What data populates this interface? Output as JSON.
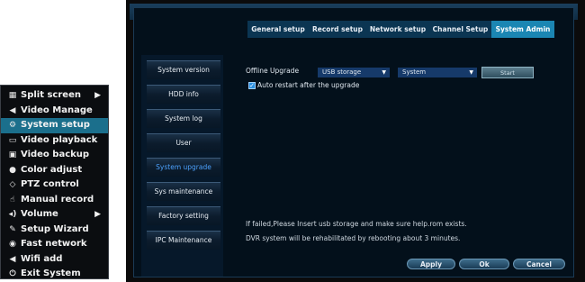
{
  "context_menu": {
    "items": [
      {
        "label": "Split screen",
        "icon": "grid-icon",
        "glyph": "▦",
        "submenu": true
      },
      {
        "label": "Video Manage",
        "icon": "camera-icon",
        "glyph": "◀",
        "submenu": false
      },
      {
        "label": "System setup",
        "icon": "gear-icon",
        "glyph": "⚙",
        "submenu": false,
        "active": true
      },
      {
        "label": "Video playback",
        "icon": "playback-icon",
        "glyph": "▭",
        "submenu": false
      },
      {
        "label": "Video backup",
        "icon": "save-icon",
        "glyph": "▣",
        "submenu": false
      },
      {
        "label": "Color adjust",
        "icon": "palette-icon",
        "glyph": "●",
        "submenu": false
      },
      {
        "label": "PTZ control",
        "icon": "ptz-icon",
        "glyph": "◇",
        "submenu": false
      },
      {
        "label": "Manual record",
        "icon": "hand-icon",
        "glyph": "☝",
        "submenu": false
      },
      {
        "label": "Volume",
        "icon": "speaker-icon",
        "glyph": "◂)",
        "submenu": true
      },
      {
        "label": "Setup Wizard",
        "icon": "wizard-icon",
        "glyph": "✎",
        "submenu": false
      },
      {
        "label": "Fast network",
        "icon": "network-icon",
        "glyph": "◉",
        "submenu": false
      },
      {
        "label": "Wifi add",
        "icon": "wifi-icon",
        "glyph": "◀",
        "submenu": false
      },
      {
        "label": "Exit System",
        "icon": "power-icon",
        "glyph": "⏻",
        "submenu": false
      }
    ],
    "submenu_arrow": "▶"
  },
  "tabs": [
    {
      "label": "General setup"
    },
    {
      "label": "Record setup"
    },
    {
      "label": "Network setup"
    },
    {
      "label": "Channel Setup"
    },
    {
      "label": "System Admin",
      "active": true
    }
  ],
  "nav": [
    {
      "label": "System version"
    },
    {
      "label": "HDD info"
    },
    {
      "label": "System log"
    },
    {
      "label": "User"
    },
    {
      "label": "System upgrade",
      "active": true
    },
    {
      "label": "Sys maintenance"
    },
    {
      "label": "Factory setting"
    },
    {
      "label": "IPC Maintenance"
    }
  ],
  "upgrade": {
    "offline_label": "Offline Upgrade",
    "source_value": "USB storage",
    "file_value": "System",
    "start_label": "Start",
    "auto_restart_label": "Auto restart after the upgrade",
    "auto_restart_checked": true
  },
  "notes": {
    "line1": "If failed,Please Insert usb storage and make sure help.rom exists.",
    "line2": "DVR system will be rehabilitated by rebooting about 3 minutes."
  },
  "buttons": {
    "apply": "Apply",
    "ok": "Ok",
    "cancel": "Cancel"
  },
  "colors": {
    "active_tab": "#1b86b3",
    "active_nav_text": "#4da3ff",
    "menu_highlight": "#1b6f8c"
  }
}
